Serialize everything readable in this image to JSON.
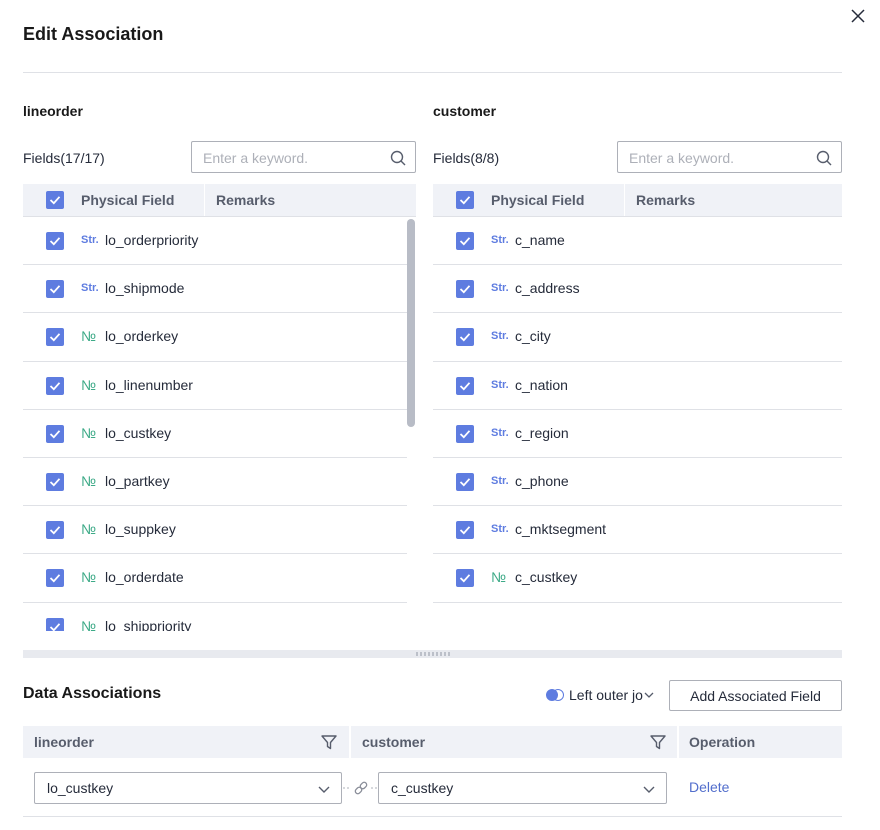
{
  "dialog": {
    "title": "Edit Association",
    "close_icon": "close-icon"
  },
  "left": {
    "table_name": "lineorder",
    "fields_count": "Fields(17/17)",
    "search_placeholder": "Enter a keyword.",
    "columns": [
      "Physical Field",
      "Remarks"
    ],
    "rows": [
      {
        "type": "Str.",
        "kind": "str",
        "name": "lo_orderpriority"
      },
      {
        "type": "Str.",
        "kind": "str",
        "name": "lo_shipmode"
      },
      {
        "type": "№",
        "kind": "num",
        "name": "lo_orderkey"
      },
      {
        "type": "№",
        "kind": "num",
        "name": "lo_linenumber"
      },
      {
        "type": "№",
        "kind": "num",
        "name": "lo_custkey"
      },
      {
        "type": "№",
        "kind": "num",
        "name": "lo_partkey"
      },
      {
        "type": "№",
        "kind": "num",
        "name": "lo_suppkey"
      },
      {
        "type": "№",
        "kind": "num",
        "name": "lo_orderdate"
      },
      {
        "type": "№",
        "kind": "num",
        "name": "lo_shippriority"
      }
    ]
  },
  "right": {
    "table_name": "customer",
    "fields_count": "Fields(8/8)",
    "search_placeholder": "Enter a keyword.",
    "columns": [
      "Physical Field",
      "Remarks"
    ],
    "rows": [
      {
        "type": "Str.",
        "kind": "str",
        "name": "c_name"
      },
      {
        "type": "Str.",
        "kind": "str",
        "name": "c_address"
      },
      {
        "type": "Str.",
        "kind": "str",
        "name": "c_city"
      },
      {
        "type": "Str.",
        "kind": "str",
        "name": "c_nation"
      },
      {
        "type": "Str.",
        "kind": "str",
        "name": "c_region"
      },
      {
        "type": "Str.",
        "kind": "str",
        "name": "c_phone"
      },
      {
        "type": "Str.",
        "kind": "str",
        "name": "c_mktsegment"
      },
      {
        "type": "№",
        "kind": "num",
        "name": "c_custkey"
      }
    ]
  },
  "associations": {
    "title": "Data Associations",
    "join_type": "Left outer joi",
    "add_button": "Add Associated Field",
    "columns": {
      "left": "lineorder",
      "right": "customer",
      "operation": "Operation"
    },
    "rows": [
      {
        "left_value": "lo_custkey",
        "right_value": "c_custkey",
        "action": "Delete"
      }
    ]
  },
  "colors": {
    "accent": "#5e7ce0",
    "string_type": "#5e7ce0",
    "number_type": "#3daa87",
    "link": "#526ecc"
  }
}
